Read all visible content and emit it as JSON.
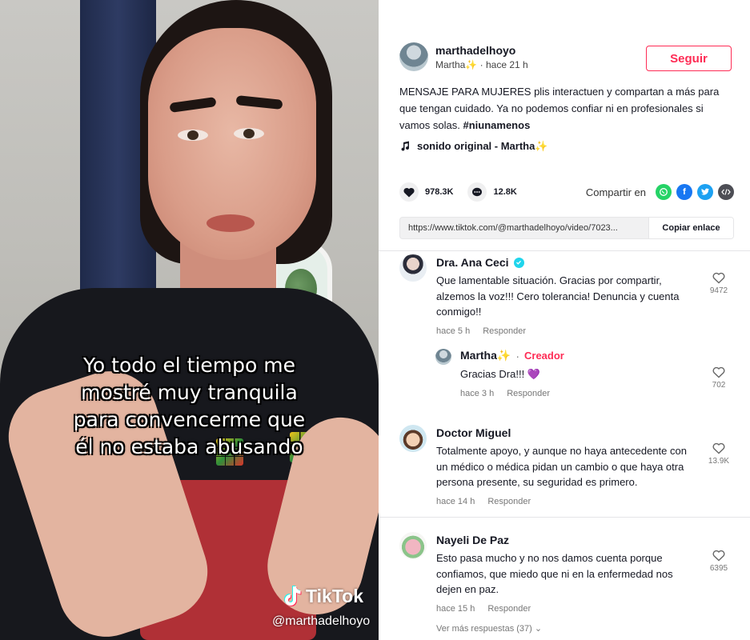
{
  "video": {
    "caption_lines": [
      "Yo todo el tiempo me",
      "mostré muy tranquila",
      "para convencerme que",
      "él no estaba abusando"
    ],
    "watermark_logo": "TikTok",
    "watermark_handle": "@marthadelhoyo"
  },
  "post": {
    "username": "marthadelhoyo",
    "nickname": "Martha✨",
    "time": "hace 21 h",
    "follow_label": "Seguir",
    "description": "MENSAJE PARA MUJERES plis interactuen y compartan a más para que tengan cuidado. Ya no podemos confiar ni en profesionales si vamos solas.",
    "hashtag": "#niunamenos",
    "music": "sonido original - Martha✨",
    "likes": "978.3K",
    "comments": "12.8K",
    "share_label": "Compartir en",
    "share_icons": [
      "whatsapp-icon",
      "facebook-icon",
      "twitter-icon",
      "embed-icon"
    ],
    "link_url": "https://www.tiktok.com/@marthadelhoyo/video/7023...",
    "copy_label": "Copiar enlace"
  },
  "comments": [
    {
      "name": "Dra. Ana Ceci",
      "verified": true,
      "text": "Que lamentable situación. Gracias por compartir, alzemos la voz!!! Cero tolerancia! Denuncia y cuenta conmigo!!",
      "time": "hace 5 h",
      "reply_label": "Responder",
      "likes": "9472",
      "reply": {
        "name": "Martha✨",
        "badge": "Creador",
        "text": "Gracias Dra!!! 💜",
        "time": "hace 3 h",
        "reply_label": "Responder",
        "likes": "702"
      }
    },
    {
      "name": "Doctor Miguel",
      "text": "Totalmente apoyo, y aunque no haya antecedente con un médico o médica pidan un cambio o que haya otra persona presente, su seguridad es primero.",
      "time": "hace 14 h",
      "reply_label": "Responder",
      "likes": "13.9K"
    },
    {
      "name": "Nayeli De Paz",
      "text": "Esto pasa mucho y no nos damos cuenta porque confiamos, que miedo que ni en la enfermedad nos dejen en paz.",
      "time": "hace 15 h",
      "reply_label": "Responder",
      "likes": "6395",
      "more_replies": "Ver más respuestas (37)"
    }
  ],
  "colors": {
    "accent": "#fe2c55",
    "verified": "#20d5ec",
    "whatsapp": "#25d366",
    "facebook": "#1877f2",
    "twitter": "#1da1f2"
  }
}
